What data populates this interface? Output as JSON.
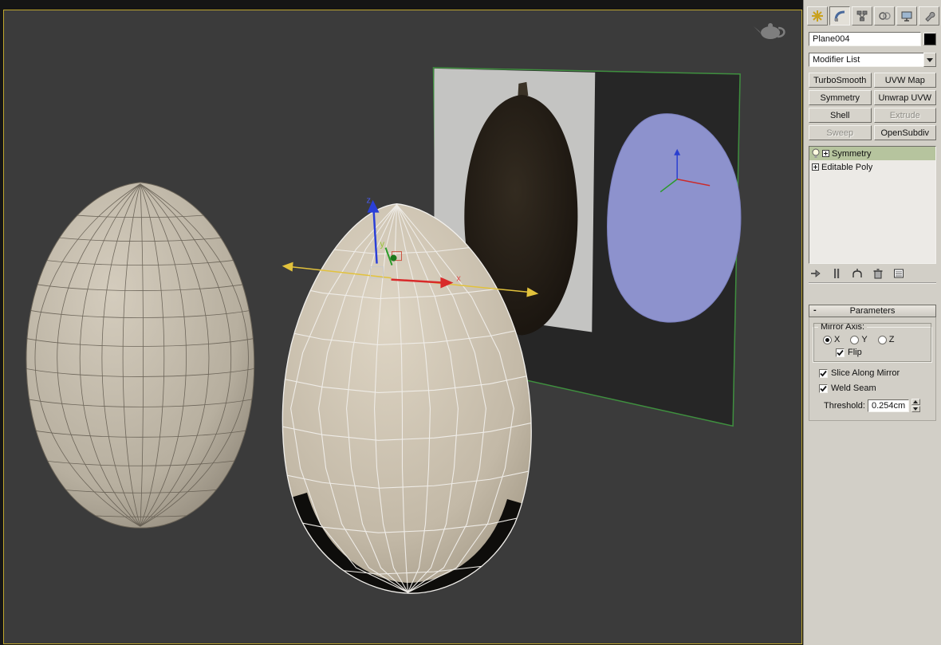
{
  "command_panel": {
    "tabs": [
      {
        "name": "create",
        "active": false
      },
      {
        "name": "modify",
        "active": true
      },
      {
        "name": "hierarchy",
        "active": false
      },
      {
        "name": "motion",
        "active": false
      },
      {
        "name": "display",
        "active": false
      },
      {
        "name": "utilities",
        "active": false
      }
    ],
    "object_name_field": {
      "value": "Plane004"
    },
    "modifier_list": {
      "label": "Modifier List"
    },
    "modifier_buttons": [
      {
        "label": "TurboSmooth",
        "enabled": true
      },
      {
        "label": "UVW Map",
        "enabled": true
      },
      {
        "label": "Symmetry",
        "enabled": true
      },
      {
        "label": "Unwrap UVW",
        "enabled": true
      },
      {
        "label": "Shell",
        "enabled": true
      },
      {
        "label": "Extrude",
        "enabled": false
      },
      {
        "label": "Sweep",
        "enabled": false
      },
      {
        "label": "OpenSubdiv",
        "enabled": true
      }
    ],
    "modifier_stack": {
      "items": [
        {
          "label": "Symmetry",
          "selected": true,
          "bulb": true
        },
        {
          "label": "Editable Poly",
          "selected": false
        }
      ]
    },
    "stack_toolbar_icons": [
      "pin-stack",
      "show-end-result",
      "make-unique",
      "remove-modifier",
      "configure-modifier-sets"
    ],
    "parameters_rollout": {
      "collapse_glyph": "-",
      "title": "Parameters",
      "mirror_axis": {
        "label": "Mirror Axis:",
        "options": [
          {
            "label": "X",
            "selected": true
          },
          {
            "label": "Y",
            "selected": false
          },
          {
            "label": "Z",
            "selected": false
          }
        ],
        "flip": {
          "label": "Flip",
          "checked": true
        }
      },
      "slice_along_mirror": {
        "label": "Slice Along Mirror",
        "checked": true
      },
      "weld_seam": {
        "label": "Weld Seam",
        "checked": true
      },
      "threshold": {
        "label": "Threshold:",
        "value": "0.254cm"
      }
    }
  },
  "viewport": {
    "border_color": "#bfa72e",
    "background_color": "#3b3b3b",
    "gizmo_labels": {
      "x": "x",
      "y": "y",
      "z": "z"
    },
    "objects": [
      "smoothed-egg-mesh",
      "selected-poly-egg-mesh",
      "reference-plane-with-seed-photo-and-blue-silhouette"
    ]
  }
}
